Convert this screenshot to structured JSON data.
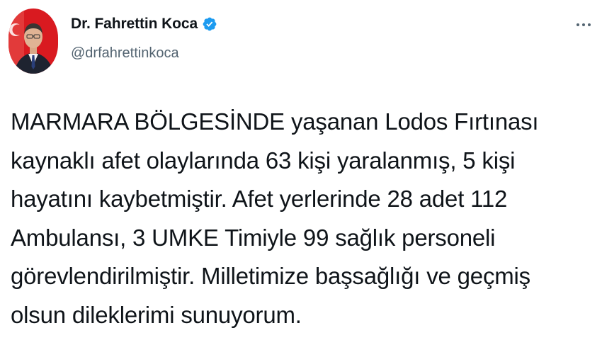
{
  "author": {
    "display_name": "Dr. Fahrettin Koca",
    "handle": "@drfahrettinkoca",
    "verified_icon": "verified-badge-icon",
    "avatar_icon": "profile-avatar"
  },
  "tweet": {
    "lines": [
      "MARMARA BÖLGESİNDE yaşanan Lodos Fırtınası",
      "kaynaklı afet olaylarında 63 kişi yaralanmış, 5 kişi",
      "hayatını kaybetmiştir. Afet yerlerinde 28 adet 112",
      "Ambulansı, 3 UMKE Timiyle 99 sağlık personeli",
      "görevlendirilmiştir. Milletimize başsağlığı ve geçmiş",
      "olsun dileklerimi sunuyorum."
    ]
  },
  "actions": {
    "more_icon": "more-options-icon"
  },
  "colors": {
    "text": "#0f1419",
    "secondary_text": "#536471",
    "verified_blue": "#1d9bf0",
    "background": "#ffffff"
  }
}
